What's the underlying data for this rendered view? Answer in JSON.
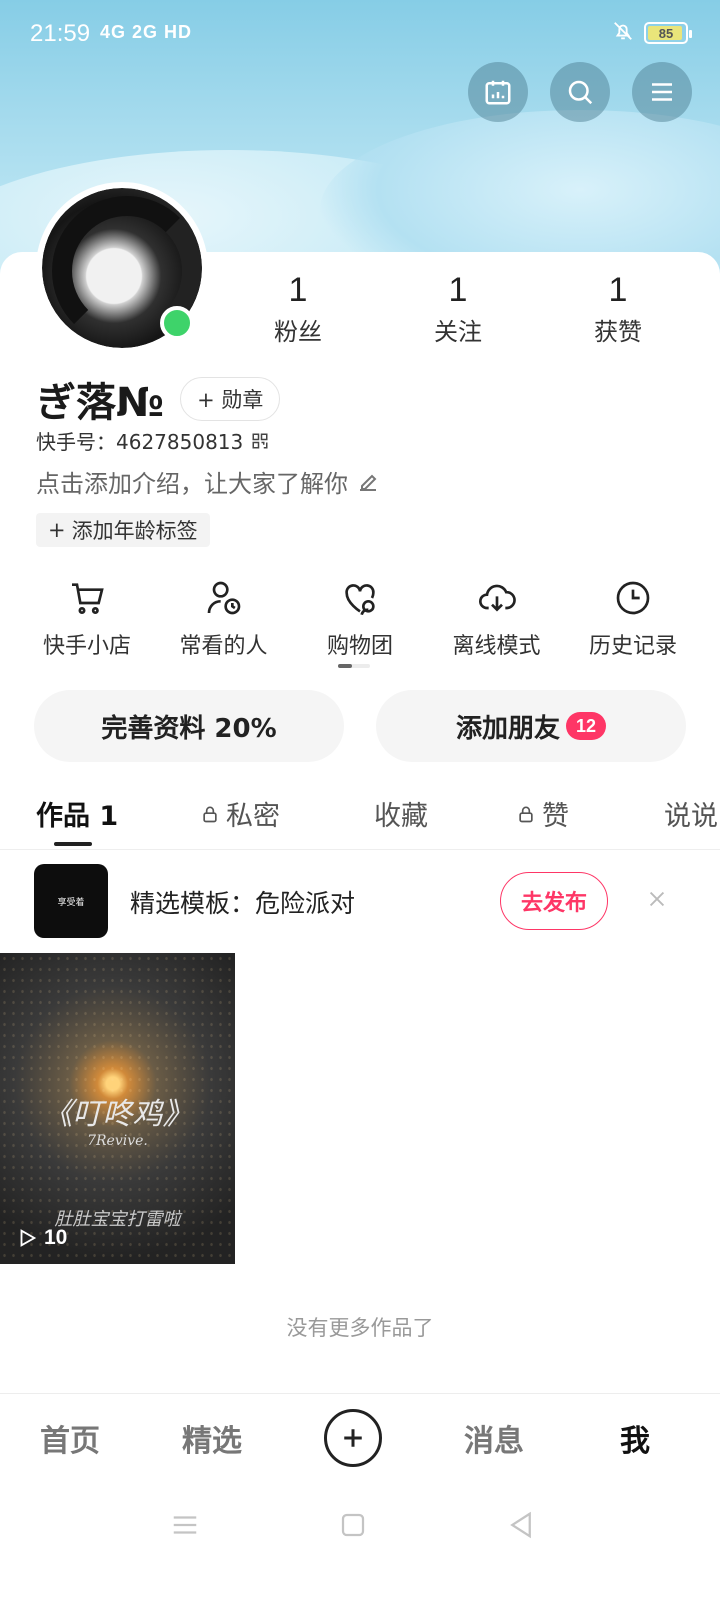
{
  "status_bar": {
    "time": "21:59",
    "network": "4G 2G HD",
    "battery": "85"
  },
  "profile": {
    "name": "ぎ落№",
    "medal_label": "+ 勋章",
    "kuaishou_id": "快手号：4627850813",
    "intro_placeholder": "点击添加介绍，让大家了解你",
    "age_tag": "添加年龄标签",
    "online": true
  },
  "stats": [
    {
      "value": "1",
      "label": "粉丝"
    },
    {
      "value": "1",
      "label": "关注"
    },
    {
      "value": "1",
      "label": "获赞"
    }
  ],
  "shortcuts": [
    {
      "label": "快手小店",
      "icon": "cart-icon"
    },
    {
      "label": "常看的人",
      "icon": "person-clock-icon"
    },
    {
      "label": "购物团",
      "icon": "heart-group-icon"
    },
    {
      "label": "离线模式",
      "icon": "cloud-download-icon"
    },
    {
      "label": "历史记录",
      "icon": "clock-icon"
    }
  ],
  "actions": {
    "complete_profile": "完善资料 20%",
    "add_friends": "添加朋友",
    "add_friends_badge": "12"
  },
  "tabs": [
    {
      "label": "作品 1",
      "locked": false,
      "active": true
    },
    {
      "label": "私密",
      "locked": true,
      "active": false
    },
    {
      "label": "收藏",
      "locked": false,
      "active": false
    },
    {
      "label": "赞",
      "locked": true,
      "active": false
    },
    {
      "label": "说说",
      "locked": false,
      "active": false
    }
  ],
  "template_suggestion": {
    "thumb_text": "享受着",
    "text": "精选模板：危险派对",
    "publish_label": "去发布"
  },
  "videos": [
    {
      "title": "《叮咚鸡》",
      "subtitle": "7Revive.",
      "caption": "肚肚宝宝打雷啦",
      "play_count": "10"
    }
  ],
  "no_more_text": "没有更多作品了",
  "bottom_nav": {
    "home": "首页",
    "featured": "精选",
    "messages": "消息",
    "me": "我"
  },
  "colors": {
    "accent": "#fe3666",
    "online": "#3ed36a",
    "banner": "#9fd8ec"
  }
}
